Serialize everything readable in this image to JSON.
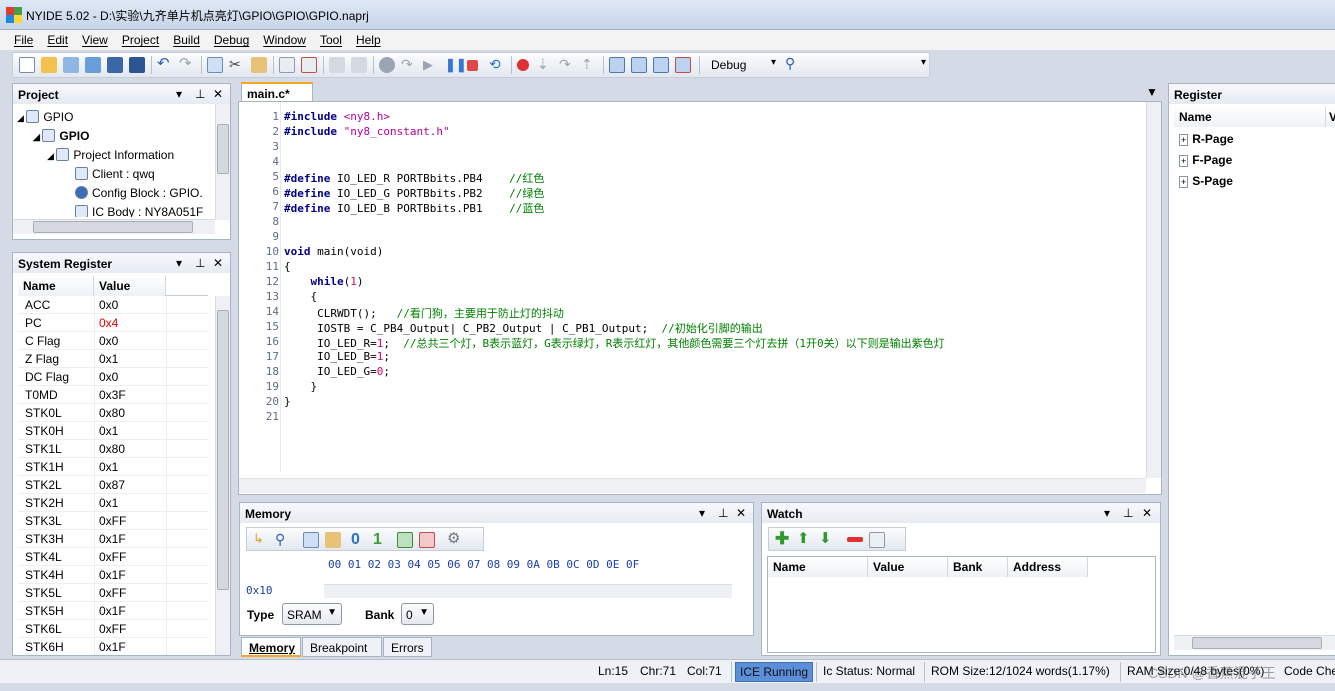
{
  "window": {
    "title": "NYIDE 5.02  -  D:\\实验\\九齐单片机点亮灯\\GPIO\\GPIO\\GPIO.naprj"
  },
  "menu": [
    "File",
    "Edit",
    "View",
    "Project",
    "Build",
    "Debug",
    "Window",
    "Tool",
    "Help"
  ],
  "toolbar": {
    "config": "Debug",
    "config_arrow": "▾",
    "find_arrow": "▾"
  },
  "project_panel": {
    "title": "Project",
    "tree": [
      {
        "label": "GPIO",
        "icon": "solution-icon"
      },
      {
        "label": "GPIO",
        "icon": "project-icon"
      },
      {
        "label": "Project Information",
        "icon": "info-icon"
      },
      {
        "label": "Client : qwq",
        "icon": "client-icon"
      },
      {
        "label": "Config Block : GPIO.",
        "icon": "config-icon"
      },
      {
        "label": "IC Body : NY8A051F",
        "icon": "chip-icon"
      }
    ]
  },
  "system_register": {
    "title": "System Register",
    "columns": [
      "Name",
      "Value"
    ],
    "rows": [
      {
        "name": "ACC",
        "value": "0x0",
        "changed": false
      },
      {
        "name": "PC",
        "value": "0x4",
        "changed": true
      },
      {
        "name": "C Flag",
        "value": "0x0",
        "changed": false
      },
      {
        "name": "Z Flag",
        "value": "0x1",
        "changed": false
      },
      {
        "name": "DC Flag",
        "value": "0x0",
        "changed": false
      },
      {
        "name": "T0MD",
        "value": "0x3F",
        "changed": false
      },
      {
        "name": "STK0L",
        "value": "0x80",
        "changed": false
      },
      {
        "name": "STK0H",
        "value": "0x1",
        "changed": false
      },
      {
        "name": "STK1L",
        "value": "0x80",
        "changed": false
      },
      {
        "name": "STK1H",
        "value": "0x1",
        "changed": false
      },
      {
        "name": "STK2L",
        "value": "0x87",
        "changed": false
      },
      {
        "name": "STK2H",
        "value": "0x1",
        "changed": false
      },
      {
        "name": "STK3L",
        "value": "0xFF",
        "changed": false
      },
      {
        "name": "STK3H",
        "value": "0x1F",
        "changed": false
      },
      {
        "name": "STK4L",
        "value": "0xFF",
        "changed": false
      },
      {
        "name": "STK4H",
        "value": "0x1F",
        "changed": false
      },
      {
        "name": "STK5L",
        "value": "0xFF",
        "changed": false
      },
      {
        "name": "STK5H",
        "value": "0x1F",
        "changed": false
      },
      {
        "name": "STK6L",
        "value": "0xFF",
        "changed": false
      },
      {
        "name": "STK6H",
        "value": "0x1F",
        "changed": false
      }
    ]
  },
  "editor": {
    "tab": "main.c*",
    "lines": [
      [
        [
          "pp",
          "#include "
        ],
        [
          "str",
          "<ny8.h>"
        ]
      ],
      [
        [
          "pp",
          "#include "
        ],
        [
          "str",
          "\"ny8_constant.h\""
        ]
      ],
      [],
      [],
      [
        [
          "pp",
          "#define "
        ],
        [
          "plain",
          "IO_LED_R PORTBbits.PB4    "
        ],
        [
          "cm",
          "//红色"
        ]
      ],
      [
        [
          "pp",
          "#define "
        ],
        [
          "plain",
          "IO_LED_G PORTBbits.PB2    "
        ],
        [
          "cm",
          "//绿色"
        ]
      ],
      [
        [
          "pp",
          "#define "
        ],
        [
          "plain",
          "IO_LED_B PORTBbits.PB1    "
        ],
        [
          "cm",
          "//蓝色"
        ]
      ],
      [],
      [],
      [
        [
          "kw",
          "void "
        ],
        [
          "plain",
          "main(void)"
        ]
      ],
      [
        [
          "plain",
          "{"
        ]
      ],
      [
        [
          "plain",
          "    "
        ],
        [
          "kw",
          "while"
        ],
        [
          "plain",
          "("
        ],
        [
          "num",
          "1"
        ],
        [
          "plain",
          ")"
        ]
      ],
      [
        [
          "plain",
          "    {"
        ]
      ],
      [
        [
          "plain",
          "     CLRWDT();   "
        ],
        [
          "cm",
          "//看门狗，主要用于防止灯的抖动"
        ]
      ],
      [
        [
          "plain",
          "     IOSTB = C_PB4_Output| C_PB2_Output | C_PB1_Output;  "
        ],
        [
          "cm",
          "//初始化引脚的输出"
        ]
      ],
      [
        [
          "plain",
          "     IO_LED_R="
        ],
        [
          "num",
          "1"
        ],
        [
          "plain",
          ";  "
        ],
        [
          "cm",
          "//总共三个灯，B表示蓝灯，G表示绿灯，R表示红灯，其他颜色需要三个灯去拼（1开0关）以下则是输出紫色灯"
        ]
      ],
      [
        [
          "plain",
          "     IO_LED_B="
        ],
        [
          "num",
          "1"
        ],
        [
          "plain",
          ";"
        ]
      ],
      [
        [
          "plain",
          "     IO_LED_G="
        ],
        [
          "num",
          "0"
        ],
        [
          "plain",
          ";"
        ]
      ],
      [
        [
          "plain",
          "    }"
        ]
      ],
      [
        [
          "plain",
          "}"
        ]
      ],
      []
    ]
  },
  "memory_panel": {
    "title": "Memory",
    "header": "00 01 02 03 04 05 06 07 08 09 0A 0B 0C 0D 0E 0F",
    "address": "0x10",
    "type_label": "Type",
    "type_value": "SRAM",
    "bank_label": "Bank",
    "bank_value": "0"
  },
  "watch_panel": {
    "title": "Watch",
    "columns": [
      "Name",
      "Value",
      "Bank",
      "Address"
    ]
  },
  "register_panel": {
    "title": "Register",
    "columns": [
      "Name",
      "V"
    ],
    "items": [
      "R-Page",
      "F-Page",
      "S-Page"
    ]
  },
  "bottom_tabs": [
    "Memory",
    "Breakpoint",
    "Errors"
  ],
  "status": {
    "ln": "Ln:15",
    "chr": "Chr:71",
    "col": "Col:71",
    "ice": "ICE Running",
    "ic_status": "Ic Status: Normal",
    "rom": "ROM Size:12/1024 words(1.17%)",
    "ram": "RAM Size:0/48 bytes(0%)",
    "code": "Code Che",
    "watermark": "CSDN @香蕉混子王"
  },
  "colors": {
    "accent": "#f5a623",
    "ice_bg": "#5b8fd9",
    "changed_value": "#e00000"
  }
}
